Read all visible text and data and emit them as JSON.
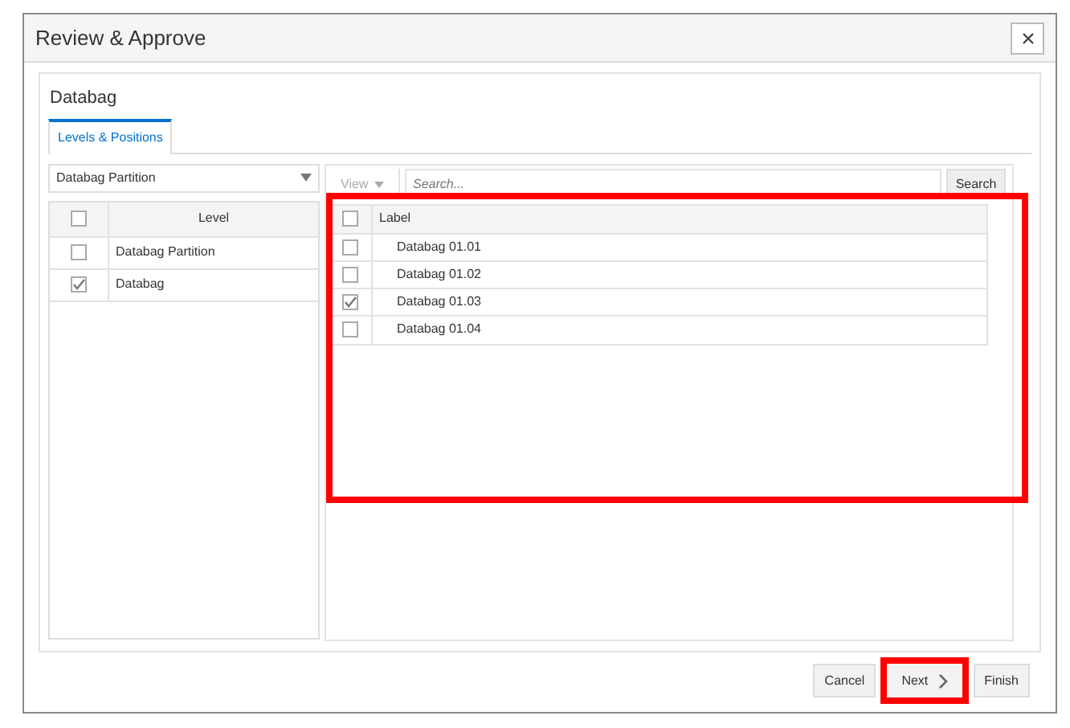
{
  "window": {
    "title": "Review & Approve"
  },
  "section_title": "Databag",
  "tabs": [
    {
      "label": "Levels & Positions",
      "selected": true
    }
  ],
  "level_dropdown": {
    "value": "Databag Partition"
  },
  "levels_table": {
    "columns": [
      "Level"
    ],
    "header_checked": false,
    "rows": [
      {
        "label": "Databag Partition",
        "checked": false
      },
      {
        "label": "Databag",
        "checked": true
      }
    ]
  },
  "toolbar": {
    "view": "View",
    "search_placeholder": "Search...",
    "search_button": "Search"
  },
  "labels_table": {
    "columns": [
      "Label"
    ],
    "header_checked": false,
    "highlighted": true,
    "rows": [
      {
        "label": "Databag 01.01",
        "checked": false
      },
      {
        "label": "Databag 01.02",
        "checked": false
      },
      {
        "label": "Databag 01.03",
        "checked": true
      },
      {
        "label": "Databag 01.04",
        "checked": false
      }
    ]
  },
  "buttons": [
    {
      "label": "Cancel",
      "kind": "plain",
      "highlighted": false
    },
    {
      "label": "Next",
      "kind": "next",
      "highlighted": true
    },
    {
      "label": "Finish",
      "kind": "plain",
      "highlighted": false
    }
  ]
}
